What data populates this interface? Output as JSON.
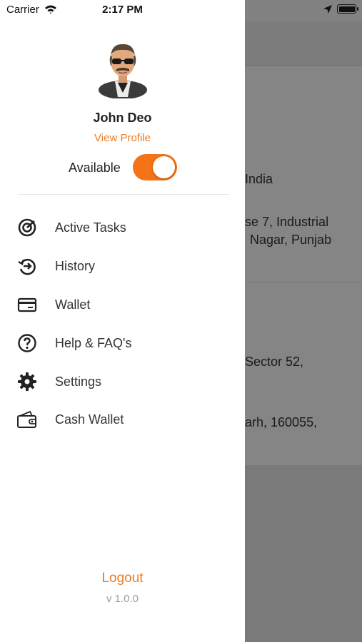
{
  "status_bar": {
    "carrier": "Carrier",
    "time": "2:17 PM",
    "icons": [
      "wifi-icon",
      "location-arrow-icon",
      "battery-icon"
    ]
  },
  "profile": {
    "name": "John Deo",
    "view_profile": "View Profile",
    "availability_label": "Available",
    "available": true
  },
  "menu": {
    "items": [
      {
        "label": "Active Tasks",
        "icon": "target-icon"
      },
      {
        "label": "History",
        "icon": "history-icon"
      },
      {
        "label": "Wallet",
        "icon": "card-icon"
      },
      {
        "label": "Help & FAQ's",
        "icon": "help-icon"
      },
      {
        "label": "Settings",
        "icon": "gear-icon"
      },
      {
        "label": "Cash Wallet",
        "icon": "cash-wallet-icon"
      }
    ]
  },
  "footer": {
    "logout": "Logout",
    "version": "v 1.0.0"
  },
  "background": {
    "lines": [
      "India",
      "se 7, Industrial",
      "Nagar, Punjab",
      "Sector 52,",
      "arh, 160055,"
    ]
  },
  "colors": {
    "accent": "#f57216",
    "overlay": "#828282"
  }
}
